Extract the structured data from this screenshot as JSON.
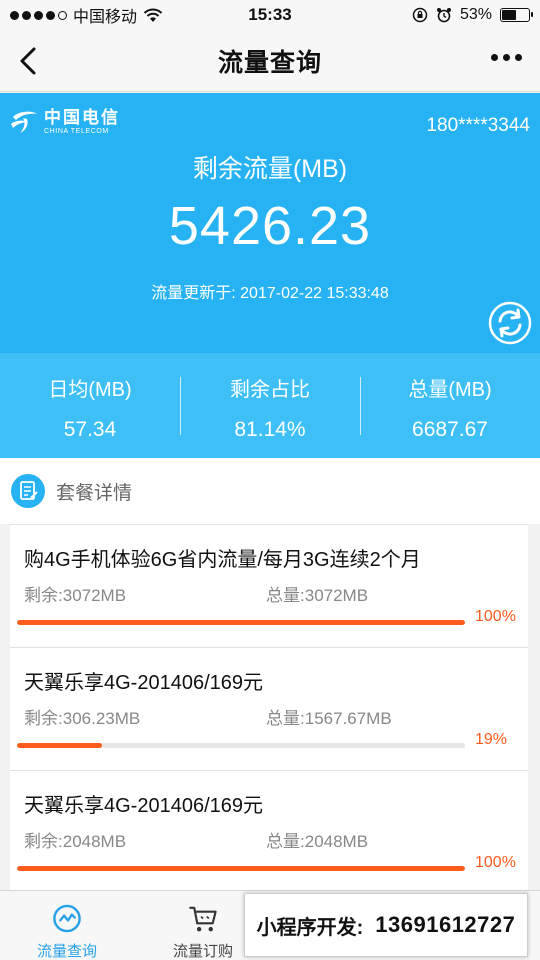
{
  "status_bar": {
    "carrier": "中国移动",
    "time": "15:33",
    "battery": "53%",
    "battery_level": 0.53
  },
  "nav": {
    "title": "流量查询"
  },
  "hero": {
    "logo_cn": "中国电信",
    "logo_en": "CHINA TELECOM",
    "phone": "180****3344",
    "label": "剩余流量(MB)",
    "value": "5426.23",
    "update_prefix": "流量更新于: ",
    "update_time": "2017-02-22 15:33:48"
  },
  "stats": [
    {
      "label": "日均(MB)",
      "value": "57.34"
    },
    {
      "label": "剩余占比",
      "value": "81.14%"
    },
    {
      "label": "总量(MB)",
      "value": "6687.67"
    }
  ],
  "section": {
    "title": "套餐详情"
  },
  "packages": [
    {
      "name": "购4G手机体验6G省内流量/每月3G连续2个月",
      "remain_label": "剩余:",
      "remain": "3072MB",
      "total_label": "总量:",
      "total": "3072MB",
      "percent": 100,
      "percent_text": "100%"
    },
    {
      "name": "天翼乐享4G-201406/169元",
      "remain_label": "剩余:",
      "remain": "306.23MB",
      "total_label": "总量:",
      "total": "1567.67MB",
      "percent": 19,
      "percent_text": "19%"
    },
    {
      "name": "天翼乐享4G-201406/169元",
      "remain_label": "剩余:",
      "remain": "2048MB",
      "total_label": "总量:",
      "total": "2048MB",
      "percent": 100,
      "percent_text": "100%"
    }
  ],
  "tabs": [
    {
      "label": "流量查询",
      "active": true
    },
    {
      "label": "流量订购",
      "active": false
    }
  ],
  "promo": {
    "text": "小程序开发:",
    "number": "13691612727"
  },
  "colors": {
    "hero_bg": "#27b3f3",
    "stats_bg": "#3ec0f7",
    "progress": "#fd5c1c",
    "tab_active": "#27a2e8"
  }
}
